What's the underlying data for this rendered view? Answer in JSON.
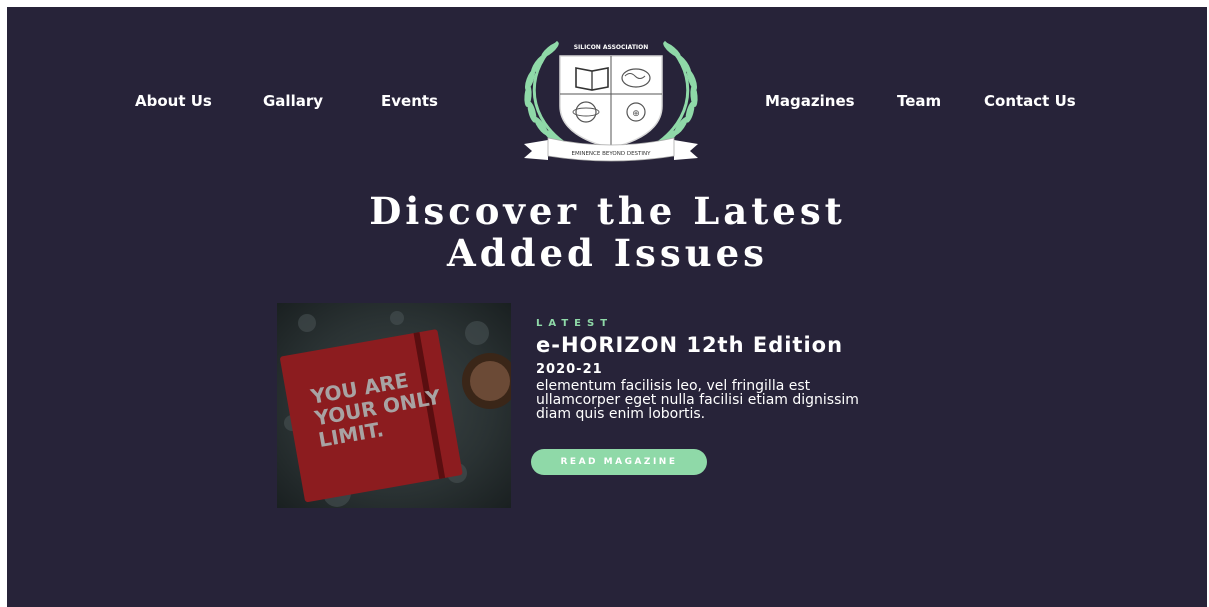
{
  "nav": {
    "about": "About Us",
    "gallery": "Gallary",
    "events": "Events",
    "magazines": "Magazines",
    "team": "Team",
    "contact": "Contact Us"
  },
  "logo": {
    "top_text": "SILICON ASSOCIATION",
    "ribbon_text": "EMINENCE BEYOND DESTINY",
    "icon": "crest-icon"
  },
  "hero": {
    "line1": "Discover the Latest",
    "line2": "Added Issues"
  },
  "issue": {
    "tag": "LATEST",
    "title": "e-HORIZON 12th Edition",
    "year": "2020-21",
    "description": "elementum facilisis leo, vel fringilla est ullamcorper eget nulla facilisi etiam dignissim diam quis enim lobortis.",
    "button": "READ MAGAZINE",
    "cover_text": [
      "YOU ARE",
      "YOUR ONLY",
      "LIMIT."
    ]
  },
  "colors": {
    "background": "#272339",
    "accent": "#8fd9a8",
    "text": "#ffffff",
    "cover_red": "#8c1c1f"
  }
}
